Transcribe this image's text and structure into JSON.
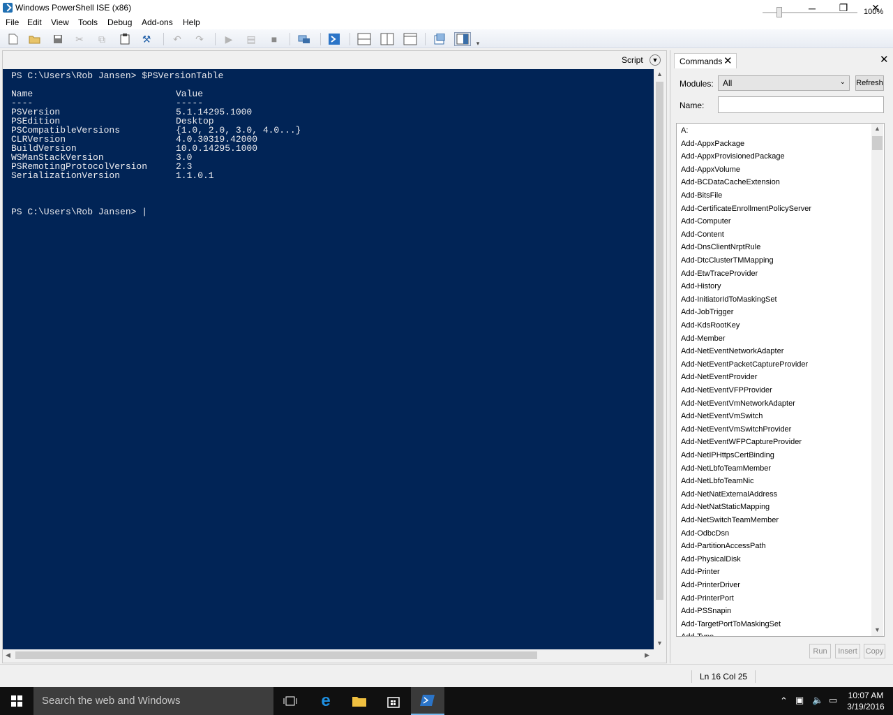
{
  "window": {
    "title": "Windows PowerShell ISE (x86)",
    "minimize": "─",
    "restore": "❐",
    "close": "✕"
  },
  "menu": [
    "File",
    "Edit",
    "View",
    "Tools",
    "Debug",
    "Add-ons",
    "Help"
  ],
  "toolbar": {
    "icons": [
      "new-file-icon",
      "open-folder-icon",
      "save-icon",
      "cut-icon",
      "copy-icon",
      "paste-icon",
      "clear-icon",
      "undo-icon",
      "redo-icon",
      "run-icon",
      "run-selection-icon",
      "stop-icon",
      "remote-icon",
      "powershell-icon",
      "layout-top-icon",
      "layout-right-icon",
      "layout-max-icon",
      "snippets-icon",
      "addon-pane-icon",
      "overflow-icon"
    ]
  },
  "console_pane": {
    "script_label": "Script",
    "lines": [
      {
        "a": "PS C:\\Users\\Rob Jansen> $PSVersionTable",
        "b": ""
      },
      {
        "a": "",
        "b": ""
      },
      {
        "a": "Name",
        "b": "Value"
      },
      {
        "a": "----",
        "b": "-----"
      },
      {
        "a": "PSVersion",
        "b": "5.1.14295.1000"
      },
      {
        "a": "PSEdition",
        "b": "Desktop"
      },
      {
        "a": "PSCompatibleVersions",
        "b": "{1.0, 2.0, 3.0, 4.0...}"
      },
      {
        "a": "CLRVersion",
        "b": "4.0.30319.42000"
      },
      {
        "a": "BuildVersion",
        "b": "10.0.14295.1000"
      },
      {
        "a": "WSManStackVersion",
        "b": "3.0"
      },
      {
        "a": "PSRemotingProtocolVersion",
        "b": "2.3"
      },
      {
        "a": "SerializationVersion",
        "b": "1.1.0.1"
      },
      {
        "a": "",
        "b": ""
      },
      {
        "a": "",
        "b": ""
      },
      {
        "a": "",
        "b": ""
      },
      {
        "a": "PS C:\\Users\\Rob Jansen> |",
        "b": ""
      }
    ],
    "colors": {
      "background": "#012456",
      "text": "#eeedf0"
    }
  },
  "commands_pane": {
    "tab_label": "Commands",
    "modules_label": "Modules:",
    "modules_value": "All",
    "refresh_label": "Refresh",
    "name_label": "Name:",
    "name_value": "",
    "items": [
      "A:",
      "Add-AppxPackage",
      "Add-AppxProvisionedPackage",
      "Add-AppxVolume",
      "Add-BCDataCacheExtension",
      "Add-BitsFile",
      "Add-CertificateEnrollmentPolicyServer",
      "Add-Computer",
      "Add-Content",
      "Add-DnsClientNrptRule",
      "Add-DtcClusterTMMapping",
      "Add-EtwTraceProvider",
      "Add-History",
      "Add-InitiatorIdToMaskingSet",
      "Add-JobTrigger",
      "Add-KdsRootKey",
      "Add-Member",
      "Add-NetEventNetworkAdapter",
      "Add-NetEventPacketCaptureProvider",
      "Add-NetEventProvider",
      "Add-NetEventVFPProvider",
      "Add-NetEventVmNetworkAdapter",
      "Add-NetEventVmSwitch",
      "Add-NetEventVmSwitchProvider",
      "Add-NetEventWFPCaptureProvider",
      "Add-NetIPHttpsCertBinding",
      "Add-NetLbfoTeamMember",
      "Add-NetLbfoTeamNic",
      "Add-NetNatExternalAddress",
      "Add-NetNatStaticMapping",
      "Add-NetSwitchTeamMember",
      "Add-OdbcDsn",
      "Add-PartitionAccessPath",
      "Add-PhysicalDisk",
      "Add-Printer",
      "Add-PrinterDriver",
      "Add-PrinterPort",
      "Add-PSSnapin",
      "Add-TargetPortToMaskingSet",
      "Add-Type"
    ],
    "run_label": "Run",
    "insert_label": "Insert",
    "copy_label": "Copy"
  },
  "status": {
    "position": "Ln 16  Col 25",
    "zoom": "100%",
    "zoom_fraction": 0.18
  },
  "taskbar": {
    "search_placeholder": "Search the web and Windows",
    "time": "10:07 AM",
    "date": "3/19/2016"
  }
}
